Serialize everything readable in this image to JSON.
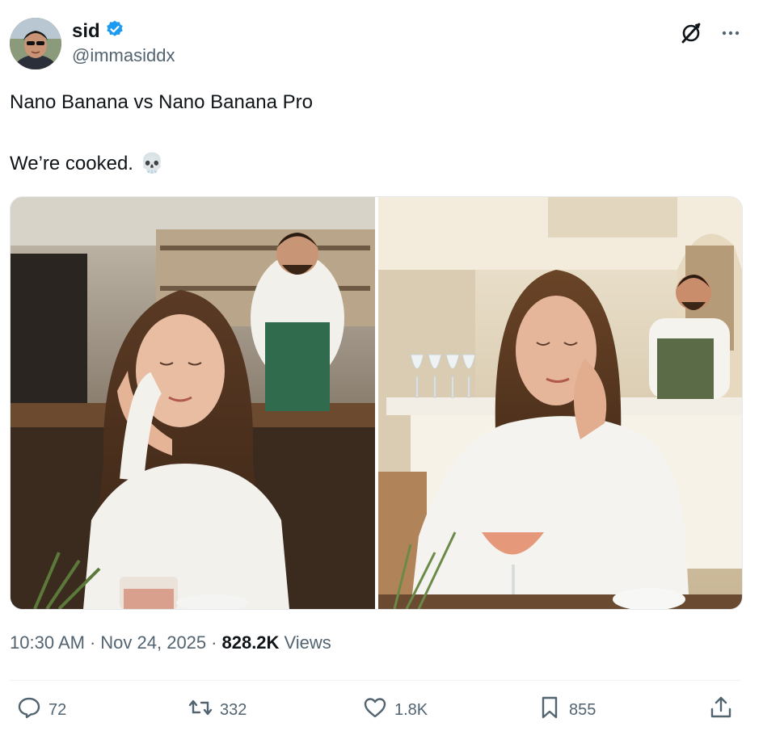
{
  "author": {
    "name": "sid",
    "handle": "@immasiddx",
    "verified_color": "#1d9bf0"
  },
  "top_icons": [
    "grok-icon",
    "more-icon"
  ],
  "tweet": {
    "line1": "Nano Banana vs Nano Banana Pro",
    "line2": "We’re cooked.",
    "emoji": "💀"
  },
  "meta": {
    "time": "10:30 AM",
    "dot1": "·",
    "date": "Nov 24, 2025",
    "dot2": "·",
    "views_count": "828.2K",
    "views_label": "Views"
  },
  "actions": {
    "replies": "72",
    "reposts": "332",
    "likes": "1.8K",
    "bookmarks": "855"
  }
}
